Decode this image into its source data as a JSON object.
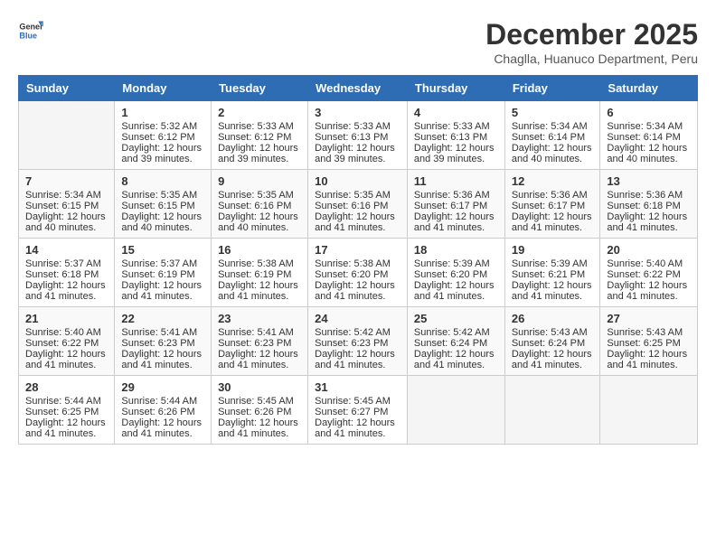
{
  "logo": {
    "text_general": "General",
    "text_blue": "Blue"
  },
  "header": {
    "month_title": "December 2025",
    "location": "Chaglla, Huanuco Department, Peru"
  },
  "weekdays": [
    "Sunday",
    "Monday",
    "Tuesday",
    "Wednesday",
    "Thursday",
    "Friday",
    "Saturday"
  ],
  "weeks": [
    [
      {
        "day": "",
        "sunrise": "",
        "sunset": "",
        "daylight": ""
      },
      {
        "day": "1",
        "sunrise": "Sunrise: 5:32 AM",
        "sunset": "Sunset: 6:12 PM",
        "daylight": "Daylight: 12 hours and 39 minutes."
      },
      {
        "day": "2",
        "sunrise": "Sunrise: 5:33 AM",
        "sunset": "Sunset: 6:12 PM",
        "daylight": "Daylight: 12 hours and 39 minutes."
      },
      {
        "day": "3",
        "sunrise": "Sunrise: 5:33 AM",
        "sunset": "Sunset: 6:13 PM",
        "daylight": "Daylight: 12 hours and 39 minutes."
      },
      {
        "day": "4",
        "sunrise": "Sunrise: 5:33 AM",
        "sunset": "Sunset: 6:13 PM",
        "daylight": "Daylight: 12 hours and 39 minutes."
      },
      {
        "day": "5",
        "sunrise": "Sunrise: 5:34 AM",
        "sunset": "Sunset: 6:14 PM",
        "daylight": "Daylight: 12 hours and 40 minutes."
      },
      {
        "day": "6",
        "sunrise": "Sunrise: 5:34 AM",
        "sunset": "Sunset: 6:14 PM",
        "daylight": "Daylight: 12 hours and 40 minutes."
      }
    ],
    [
      {
        "day": "7",
        "sunrise": "Sunrise: 5:34 AM",
        "sunset": "Sunset: 6:15 PM",
        "daylight": "Daylight: 12 hours and 40 minutes."
      },
      {
        "day": "8",
        "sunrise": "Sunrise: 5:35 AM",
        "sunset": "Sunset: 6:15 PM",
        "daylight": "Daylight: 12 hours and 40 minutes."
      },
      {
        "day": "9",
        "sunrise": "Sunrise: 5:35 AM",
        "sunset": "Sunset: 6:16 PM",
        "daylight": "Daylight: 12 hours and 40 minutes."
      },
      {
        "day": "10",
        "sunrise": "Sunrise: 5:35 AM",
        "sunset": "Sunset: 6:16 PM",
        "daylight": "Daylight: 12 hours and 41 minutes."
      },
      {
        "day": "11",
        "sunrise": "Sunrise: 5:36 AM",
        "sunset": "Sunset: 6:17 PM",
        "daylight": "Daylight: 12 hours and 41 minutes."
      },
      {
        "day": "12",
        "sunrise": "Sunrise: 5:36 AM",
        "sunset": "Sunset: 6:17 PM",
        "daylight": "Daylight: 12 hours and 41 minutes."
      },
      {
        "day": "13",
        "sunrise": "Sunrise: 5:36 AM",
        "sunset": "Sunset: 6:18 PM",
        "daylight": "Daylight: 12 hours and 41 minutes."
      }
    ],
    [
      {
        "day": "14",
        "sunrise": "Sunrise: 5:37 AM",
        "sunset": "Sunset: 6:18 PM",
        "daylight": "Daylight: 12 hours and 41 minutes."
      },
      {
        "day": "15",
        "sunrise": "Sunrise: 5:37 AM",
        "sunset": "Sunset: 6:19 PM",
        "daylight": "Daylight: 12 hours and 41 minutes."
      },
      {
        "day": "16",
        "sunrise": "Sunrise: 5:38 AM",
        "sunset": "Sunset: 6:19 PM",
        "daylight": "Daylight: 12 hours and 41 minutes."
      },
      {
        "day": "17",
        "sunrise": "Sunrise: 5:38 AM",
        "sunset": "Sunset: 6:20 PM",
        "daylight": "Daylight: 12 hours and 41 minutes."
      },
      {
        "day": "18",
        "sunrise": "Sunrise: 5:39 AM",
        "sunset": "Sunset: 6:20 PM",
        "daylight": "Daylight: 12 hours and 41 minutes."
      },
      {
        "day": "19",
        "sunrise": "Sunrise: 5:39 AM",
        "sunset": "Sunset: 6:21 PM",
        "daylight": "Daylight: 12 hours and 41 minutes."
      },
      {
        "day": "20",
        "sunrise": "Sunrise: 5:40 AM",
        "sunset": "Sunset: 6:22 PM",
        "daylight": "Daylight: 12 hours and 41 minutes."
      }
    ],
    [
      {
        "day": "21",
        "sunrise": "Sunrise: 5:40 AM",
        "sunset": "Sunset: 6:22 PM",
        "daylight": "Daylight: 12 hours and 41 minutes."
      },
      {
        "day": "22",
        "sunrise": "Sunrise: 5:41 AM",
        "sunset": "Sunset: 6:23 PM",
        "daylight": "Daylight: 12 hours and 41 minutes."
      },
      {
        "day": "23",
        "sunrise": "Sunrise: 5:41 AM",
        "sunset": "Sunset: 6:23 PM",
        "daylight": "Daylight: 12 hours and 41 minutes."
      },
      {
        "day": "24",
        "sunrise": "Sunrise: 5:42 AM",
        "sunset": "Sunset: 6:23 PM",
        "daylight": "Daylight: 12 hours and 41 minutes."
      },
      {
        "day": "25",
        "sunrise": "Sunrise: 5:42 AM",
        "sunset": "Sunset: 6:24 PM",
        "daylight": "Daylight: 12 hours and 41 minutes."
      },
      {
        "day": "26",
        "sunrise": "Sunrise: 5:43 AM",
        "sunset": "Sunset: 6:24 PM",
        "daylight": "Daylight: 12 hours and 41 minutes."
      },
      {
        "day": "27",
        "sunrise": "Sunrise: 5:43 AM",
        "sunset": "Sunset: 6:25 PM",
        "daylight": "Daylight: 12 hours and 41 minutes."
      }
    ],
    [
      {
        "day": "28",
        "sunrise": "Sunrise: 5:44 AM",
        "sunset": "Sunset: 6:25 PM",
        "daylight": "Daylight: 12 hours and 41 minutes."
      },
      {
        "day": "29",
        "sunrise": "Sunrise: 5:44 AM",
        "sunset": "Sunset: 6:26 PM",
        "daylight": "Daylight: 12 hours and 41 minutes."
      },
      {
        "day": "30",
        "sunrise": "Sunrise: 5:45 AM",
        "sunset": "Sunset: 6:26 PM",
        "daylight": "Daylight: 12 hours and 41 minutes."
      },
      {
        "day": "31",
        "sunrise": "Sunrise: 5:45 AM",
        "sunset": "Sunset: 6:27 PM",
        "daylight": "Daylight: 12 hours and 41 minutes."
      },
      {
        "day": "",
        "sunrise": "",
        "sunset": "",
        "daylight": ""
      },
      {
        "day": "",
        "sunrise": "",
        "sunset": "",
        "daylight": ""
      },
      {
        "day": "",
        "sunrise": "",
        "sunset": "",
        "daylight": ""
      }
    ]
  ]
}
